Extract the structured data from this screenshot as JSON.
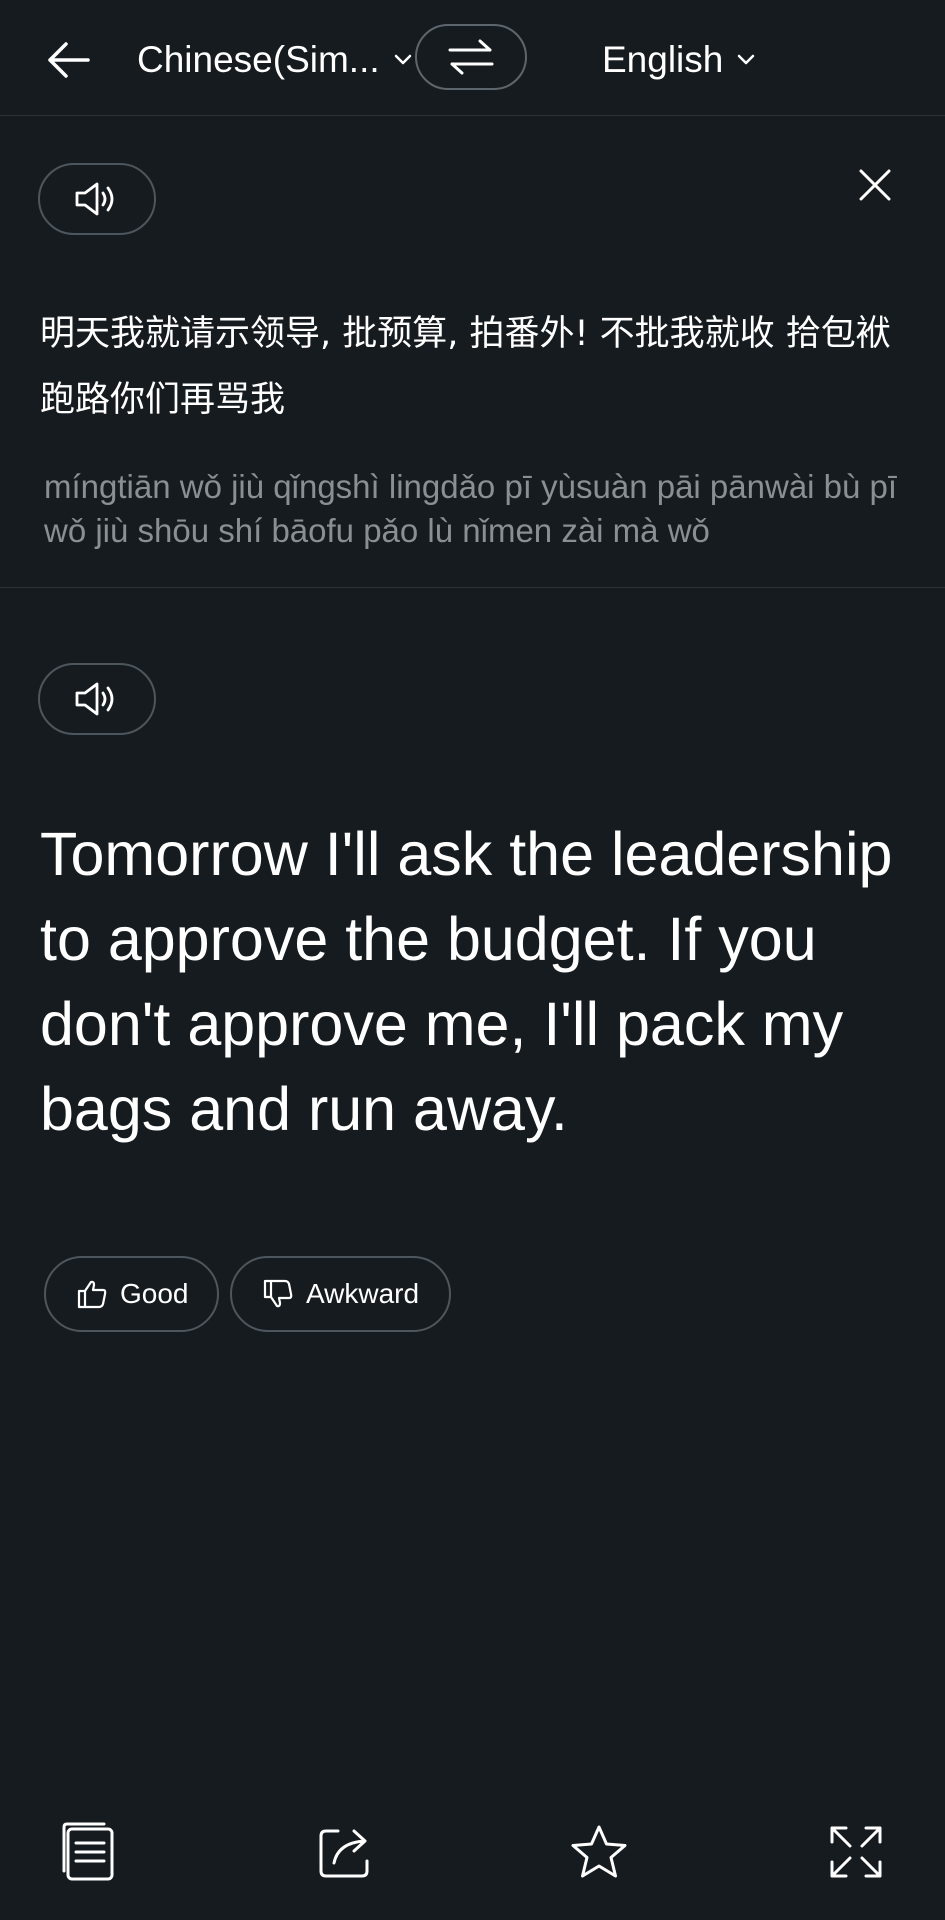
{
  "header": {
    "source_language": "Chinese(Sim...",
    "target_language": "English",
    "back_icon": "arrow-left-icon",
    "swap_icon": "swap-arrows-icon"
  },
  "source": {
    "text": "明天我就请示领导, 批预算, 拍番外! 不批我就收 拾包袱跑路你们再骂我",
    "pinyin": "míngtiān wǒ jiù qǐngshì lingdǎo pī yùsuàn pāi pānwài bù pī wǒ jiù shōu shí bāofu pǎo lù nǐmen zài mà wǒ",
    "speaker_icon": "speaker-icon",
    "close_icon": "close-icon"
  },
  "translation": {
    "text": "Tomorrow I'll ask the leadership to approve the budget. If you don't approve me, I'll pack my bags and run away.",
    "speaker_icon": "speaker-icon"
  },
  "feedback": {
    "good_label": "Good",
    "awkward_label": "Awkward"
  },
  "bottom_toolbar": {
    "items": [
      "copy-icon",
      "share-icon",
      "star-icon",
      "fullscreen-icon"
    ]
  },
  "colors": {
    "background": "#161b1f",
    "divider": "#2b3137",
    "pill_border": "#4e565d",
    "pinyin_text": "#8a8f94"
  }
}
